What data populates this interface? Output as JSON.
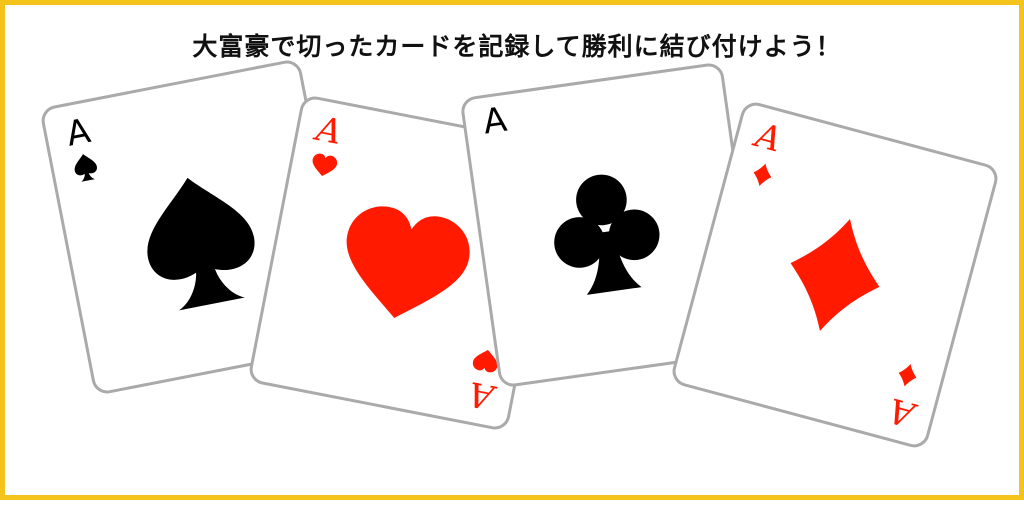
{
  "banner": {
    "title": "大富豪で切ったカードを記録して勝利に結び付けよう！",
    "border_color": "#f4c41c"
  },
  "cards": [
    {
      "rank": "A",
      "suit": "spade",
      "color": "#000000"
    },
    {
      "rank": "A",
      "suit": "heart",
      "color": "#ff1a00"
    },
    {
      "rank": "A",
      "suit": "club",
      "color": "#000000"
    },
    {
      "rank": "A",
      "suit": "diamond",
      "color": "#ff1a00"
    }
  ]
}
